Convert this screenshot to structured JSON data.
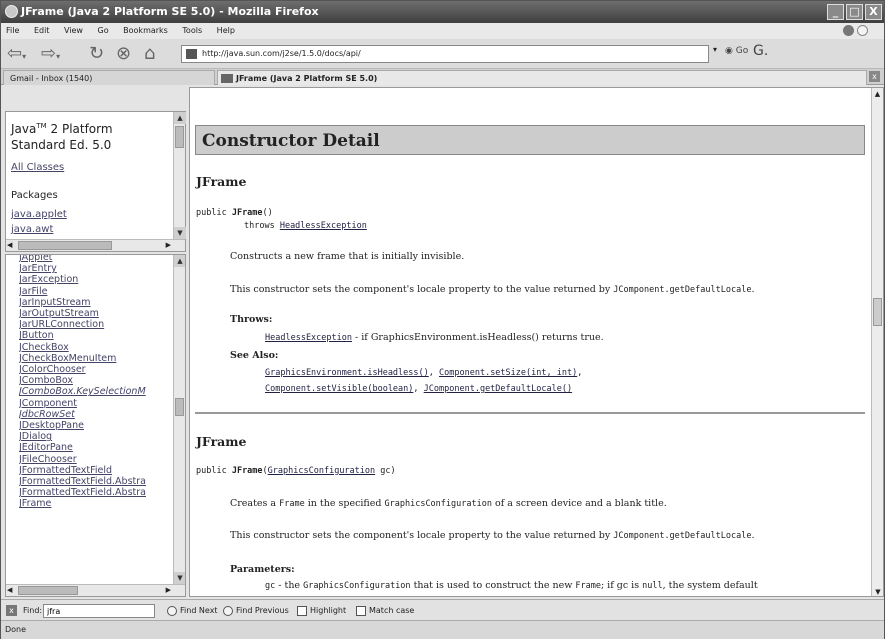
{
  "window": {
    "title": "JFrame (Java 2 Platform SE 5.0) - Mozilla Firefox",
    "buttons": {
      "minimize": "_",
      "maximize": "□",
      "close": "X"
    }
  },
  "menu": [
    "File",
    "Edit",
    "View",
    "Go",
    "Bookmarks",
    "Tools",
    "Help"
  ],
  "nav": {
    "url": "http://java.sun.com/j2se/1.5.0/docs/api/",
    "go_label": "Go"
  },
  "tabs": [
    {
      "label": "Gmail - Inbox (1540)"
    },
    {
      "label": "JFrame (Java 2 Platform SE 5.0)"
    }
  ],
  "left_top": {
    "platform_line1": "Java",
    "tm": "TM",
    "platform_line1b": " 2 Platform",
    "platform_line2": "Standard Ed. 5.0",
    "all_classes": "All Classes",
    "packages_heading": "Packages",
    "packages": [
      "java.applet",
      "java.awt"
    ]
  },
  "class_list": [
    {
      "name": "JApplet"
    },
    {
      "name": "JarEntry"
    },
    {
      "name": "JarException"
    },
    {
      "name": "JarFile"
    },
    {
      "name": "JarInputStream"
    },
    {
      "name": "JarOutputStream"
    },
    {
      "name": "JarURLConnection"
    },
    {
      "name": "JButton"
    },
    {
      "name": "JCheckBox"
    },
    {
      "name": "JCheckBoxMenuItem"
    },
    {
      "name": "JColorChooser"
    },
    {
      "name": "JComboBox"
    },
    {
      "name": "JComboBox.KeySelectionM",
      "italic": true
    },
    {
      "name": "JComponent"
    },
    {
      "name": "JdbcRowSet",
      "italic": true
    },
    {
      "name": "JDesktopPane"
    },
    {
      "name": "JDialog"
    },
    {
      "name": "JEditorPane"
    },
    {
      "name": "JFileChooser"
    },
    {
      "name": "JFormattedTextField"
    },
    {
      "name": "JFormattedTextField.Abstra"
    },
    {
      "name": "JFormattedTextField.Abstra"
    },
    {
      "name": "JFrame"
    }
  ],
  "main": {
    "section_title": "Constructor Detail",
    "c1": {
      "heading": "JFrame",
      "sig_public": "public ",
      "sig_name": "JFrame",
      "sig_rest": "()",
      "throws_kw": "throws ",
      "throws_link": "HeadlessException",
      "desc1": "Constructs a new frame that is initially invisible.",
      "desc2_pre": "This constructor sets the component's locale property to the value returned by ",
      "desc2_code": "JComponent.getDefaultLocale",
      "desc2_post": ".",
      "throws_label": "Throws:",
      "throws_item_link": "HeadlessException",
      "throws_item_text": " - if GraphicsEnvironment.isHeadless() returns true.",
      "see_also_label": "See Also:",
      "see1": "GraphicsEnvironment.isHeadless()",
      "see2": "Component.setSize(int, int)",
      "see3": "Component.setVisible(boolean)",
      "see4": "JComponent.getDefaultLocale()"
    },
    "c2": {
      "heading": "JFrame",
      "sig_public": "public ",
      "sig_name": "JFrame",
      "sig_open": "(",
      "sig_link": "GraphicsConfiguration",
      "sig_rest": " gc)",
      "desc1_pre": "Creates a ",
      "desc1_code1": "Frame",
      "desc1_mid": " in the specified ",
      "desc1_code2": "GraphicsConfiguration",
      "desc1_post": " of a screen device and a blank title.",
      "desc2_pre": "This constructor sets the component's locale property to the value returned by ",
      "desc2_code": "JComponent.getDefaultLocale",
      "desc2_post": ".",
      "params_label": "Parameters:",
      "param_code": "gc",
      "param_t1": " - the ",
      "param_code2": "GraphicsConfiguration",
      "param_t2": " that is used to construct the new ",
      "param_code3": "Frame",
      "param_t3": "; if gc is ",
      "param_code4": "null",
      "param_t4": ", the system default"
    }
  },
  "findbar": {
    "label": "Find:",
    "value": "jfra",
    "find_next": "Find Next",
    "find_prev": "Find Previous",
    "highlight": "Highlight",
    "match_case": "Match case"
  },
  "status": "Done"
}
